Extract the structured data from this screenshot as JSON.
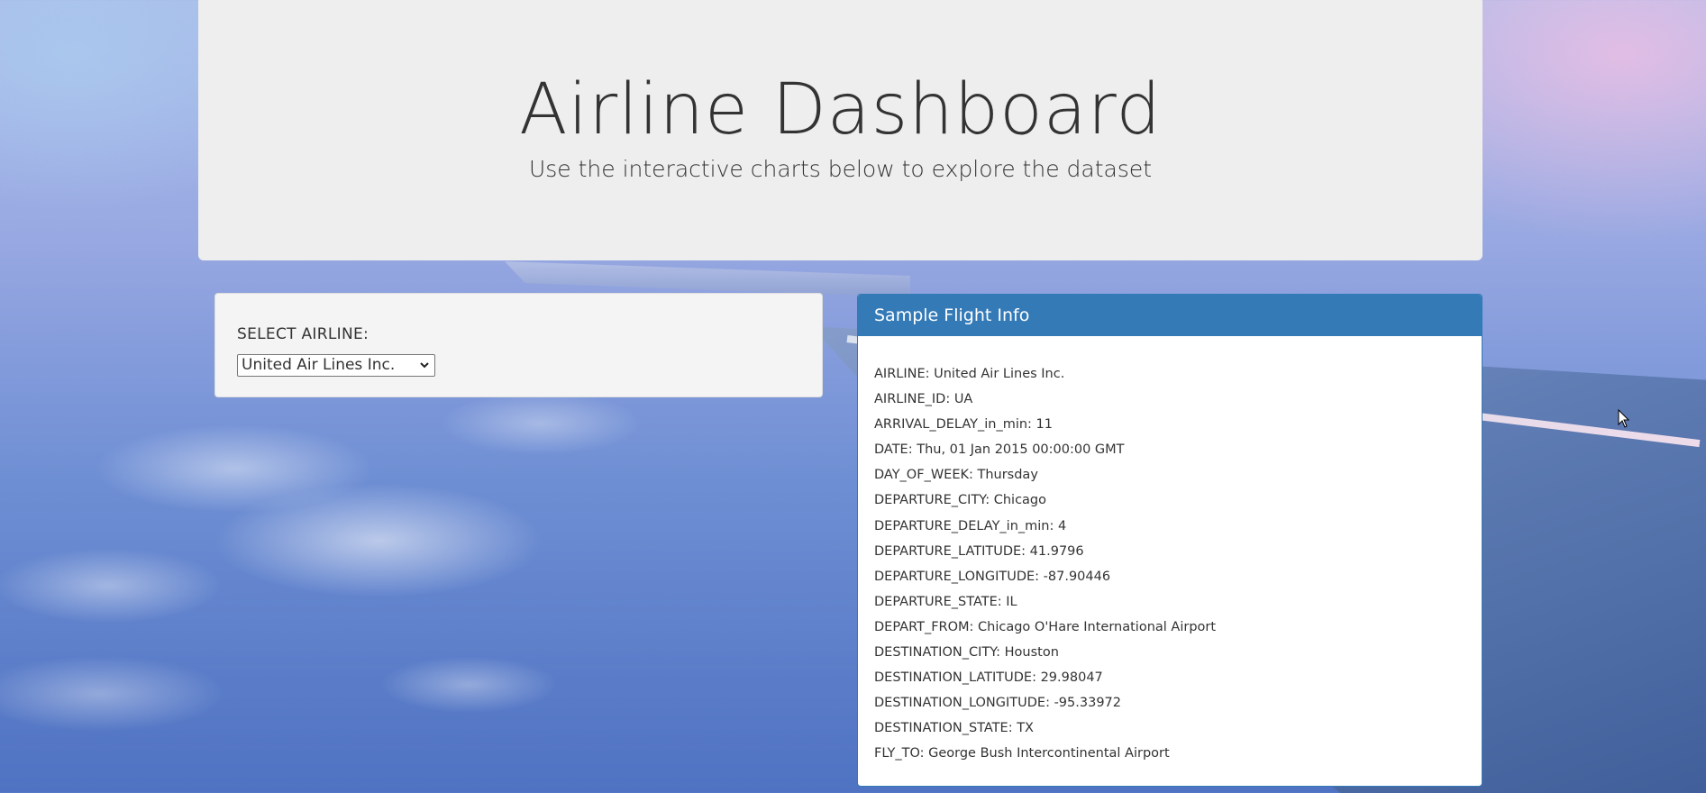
{
  "header": {
    "title": "Airline Dashboard",
    "subtitle": "Use the interactive charts below to explore the dataset"
  },
  "select_panel": {
    "label": "SELECT AIRLINE:",
    "selected": "United Air Lines Inc."
  },
  "info_panel": {
    "heading": "Sample Flight Info",
    "rows": [
      "AIRLINE: United Air Lines Inc.",
      "AIRLINE_ID: UA",
      "ARRIVAL_DELAY_in_min: 11",
      "DATE: Thu, 01 Jan 2015 00:00:00 GMT",
      "DAY_OF_WEEK: Thursday",
      "DEPARTURE_CITY: Chicago",
      "DEPARTURE_DELAY_in_min: 4",
      "DEPARTURE_LATITUDE: 41.9796",
      "DEPARTURE_LONGITUDE: -87.90446",
      "DEPARTURE_STATE: IL",
      "DEPART_FROM: Chicago O'Hare International Airport",
      "DESTINATION_CITY: Houston",
      "DESTINATION_LATITUDE: 29.98047",
      "DESTINATION_LONGITUDE: -95.33972",
      "DESTINATION_STATE: TX",
      "FLY_TO: George Bush Intercontinental Airport"
    ]
  },
  "colors": {
    "panel_heading": "#337ab7",
    "header_bg": "#eeeeee",
    "text": "#333333"
  },
  "icons": {
    "dropdown": "chevron-down-icon",
    "cursor": "mouse-pointer-icon"
  }
}
